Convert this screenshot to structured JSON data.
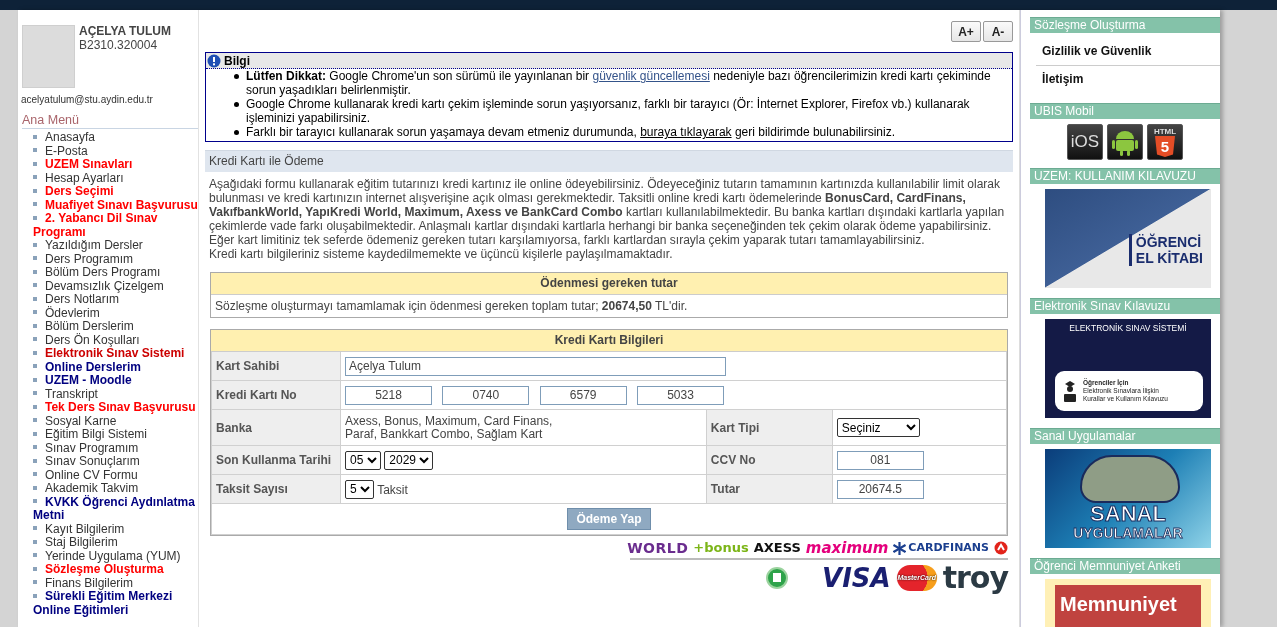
{
  "profile": {
    "name": "AÇELYA TULUM",
    "student_no": "B2310.320004",
    "email": "acelyatulum@stu.aydin.edu.tr"
  },
  "menu": {
    "title": "Ana Menü",
    "items": [
      {
        "label": "Anasayfa",
        "color": "#333333",
        "emphasized": false
      },
      {
        "label": "E-Posta",
        "color": "#333333",
        "emphasized": false
      },
      {
        "label": "UZEM Sınavları",
        "color": "#ff0000",
        "emphasized": true
      },
      {
        "label": "Hesap Ayarları",
        "color": "#333333",
        "emphasized": false
      },
      {
        "label": "Ders Seçimi",
        "color": "#ff0000",
        "emphasized": true
      },
      {
        "label": "Muafiyet Sınavı Başvurusu",
        "color": "#ff0000",
        "emphasized": true
      },
      {
        "label": "2. Yabancı Dil Sınav Programı",
        "color": "#ff0000",
        "emphasized": true
      },
      {
        "label": "Yazıldığım Dersler",
        "color": "#333333",
        "emphasized": false
      },
      {
        "label": "Ders Programım",
        "color": "#333333",
        "emphasized": false
      },
      {
        "label": "Bölüm Ders Programı",
        "color": "#333333",
        "emphasized": false
      },
      {
        "label": "Devamsızlık Çizelgem",
        "color": "#333333",
        "emphasized": false
      },
      {
        "label": "Ders Notlarım",
        "color": "#333333",
        "emphasized": false
      },
      {
        "label": "Ödevlerim",
        "color": "#333333",
        "emphasized": false
      },
      {
        "label": "Bölüm Derslerim",
        "color": "#333333",
        "emphasized": false
      },
      {
        "label": "Ders Ön Koşulları",
        "color": "#333333",
        "emphasized": false
      },
      {
        "label": "Elektronik Sınav Sistemi",
        "color": "#cc0000",
        "emphasized": true
      },
      {
        "label": "Online Derslerim",
        "color": "#000080",
        "emphasized": true
      },
      {
        "label": "UZEM - Moodle",
        "color": "#000080",
        "emphasized": true
      },
      {
        "label": "Transkript",
        "color": "#333333",
        "emphasized": false
      },
      {
        "label": "Tek Ders Sınav Başvurusu",
        "color": "#ff0000",
        "emphasized": true
      },
      {
        "label": "Sosyal Karne",
        "color": "#333333",
        "emphasized": false
      },
      {
        "label": "Eğitim Bilgi Sistemi",
        "color": "#333333",
        "emphasized": false
      },
      {
        "label": "Sınav Programım",
        "color": "#333333",
        "emphasized": false
      },
      {
        "label": "Sınav Sonuçlarım",
        "color": "#333333",
        "emphasized": false
      },
      {
        "label": "Online CV Formu",
        "color": "#333333",
        "emphasized": false
      },
      {
        "label": "Akademik Takvim",
        "color": "#333333",
        "emphasized": false
      },
      {
        "label": "KVKK Öğrenci Aydınlatma Metni",
        "color": "#000080",
        "emphasized": true
      },
      {
        "label": "Kayıt Bilgilerim",
        "color": "#333333",
        "emphasized": false
      },
      {
        "label": "Staj Bilgilerim",
        "color": "#333333",
        "emphasized": false
      },
      {
        "label": "Yerinde Uygulama (YUM)",
        "color": "#333333",
        "emphasized": false
      },
      {
        "label": "Sözleşme Oluşturma",
        "color": "#ff0000",
        "emphasized": true
      },
      {
        "label": "Finans Bilgilerim",
        "color": "#333333",
        "emphasized": false
      },
      {
        "label": "Sürekli Eğitim Merkezi Online Eğitimleri",
        "color": "#000080",
        "emphasized": true
      }
    ]
  },
  "font_buttons": [
    "A+",
    "A-"
  ],
  "notice": {
    "title": "Bilgi",
    "items": [
      [
        {
          "kind": "bold",
          "text": "Lütfen Dikkat:"
        },
        {
          "kind": "text",
          "text": " Google Chrome'un son sürümü ile yayınlanan bir "
        },
        {
          "kind": "link",
          "text": "güvenlik güncellemesi"
        },
        {
          "kind": "text",
          "text": " nedeniyle bazı öğrencilerimizin kredi kartı çekiminde sorun yaşadıkları belirlenmiştir."
        }
      ],
      [
        {
          "kind": "text",
          "text": "Google Chrome kullanarak kredi kartı çekim işleminde sorun yaşıyorsanız, farklı bir tarayıcı (Ör: İnternet Explorer, Firefox vb.) kullanarak işleminizi yapabilirsiniz."
        }
      ],
      [
        {
          "kind": "text",
          "text": "Farklı bir tarayıcı kullanarak sorun yaşamaya devam etmeniz durumunda, "
        },
        {
          "kind": "plain_link",
          "text": "buraya tıklayarak"
        },
        {
          "kind": "text",
          "text": " geri bildirimde bulunabilirsiniz."
        }
      ]
    ]
  },
  "payment": {
    "title": "Kredi Kartı ile Ödeme",
    "paragraphs": [
      "Aşağıdaki formu kullanarak eğitim tutarınızı kredi kartınız ile online ödeyebilirsiniz. Ödeyeceğiniz tutarın tamamının kartınızda kullanılabilir limit olarak bulunması ve kredi kartınızın internet alışverişine açık olması gerekmektedir. Taksitli online kredi kartı ödemelerinde **BonusCard, CardFinans, VakıfbankWorld, YapıKredi World, Maximum, Axess ve BankCard Combo** kartları kullanılabilmektedir. Bu banka kartları dışındaki kartlarla yapılan çekimlerde vade farkı oluşabilmektedir. Anlaşmalı kartlar dışındaki kartlarla herhangi bir banka seçeneğinden tek çekim olarak ödeme yapabilirsiniz.",
      "Eğer kart limitiniz tek seferde ödemeniz gereken tutarı karşılamıyorsa, farklı kartlardan sırayla çekim yaparak tutarı tamamlayabilirsiniz.",
      "Kredi kartı bilgileriniz sisteme kaydedilmemekte ve üçüncü kişilerle paylaşılmamaktadır."
    ]
  },
  "amount_due": {
    "title": "Ödenmesi gereken tutar",
    "text": "Sözleşme oluşturmayı tamamlamak için ödenmesi gereken toplam tutar; **20674,50** TL'dir."
  },
  "card_form": {
    "title": "Kredi Kartı Bilgileri",
    "cardholder": {
      "label": "Kart Sahibi",
      "value": "Açelya Tulum"
    },
    "card_number": {
      "label": "Kredi Kartı No",
      "values": [
        "5218",
        "0740",
        "6579",
        "5033"
      ]
    },
    "bank": {
      "label": "Banka",
      "text": "Axess, Bonus, Maximum, Card Finans,\nParaf, Bankkart Combo, Sağlam Kart"
    },
    "card_type": {
      "label": "Kart Tipi",
      "value": "Seçiniz"
    },
    "expiry": {
      "label": "Son Kullanma Tarihi",
      "month": "05",
      "year": "2029"
    },
    "cvv": {
      "label": "CCV No",
      "value": "081"
    },
    "installments": {
      "label": "Taksit Sayısı",
      "value": "5",
      "suffix": "Taksit"
    },
    "amount": {
      "label": "Tutar",
      "value": "20674.5"
    },
    "submit": "Ödeme Yap"
  },
  "bank_logos": [
    {
      "kind": "world",
      "text": "WORLD"
    },
    {
      "kind": "bonus",
      "text": "+bonus"
    },
    {
      "kind": "axess",
      "text": "AXESS"
    },
    {
      "kind": "maximum",
      "text": "maximum"
    },
    {
      "kind": "cardfinans",
      "text": "CARDFINANS"
    },
    {
      "kind": "paraf"
    }
  ],
  "card_logos": [
    {
      "kind": "seal"
    },
    {
      "kind": "visa",
      "text": "VISA"
    },
    {
      "kind": "mastercard",
      "text": "MasterCard"
    },
    {
      "kind": "troy",
      "text": "troy"
    }
  ],
  "right_sidebar": [
    {
      "kind": "links",
      "title": "Sözleşme Oluşturma",
      "items": [
        "Gizlilik ve Güvenlik",
        "İletişim"
      ]
    },
    {
      "kind": "apps",
      "title": "UBIS Mobil",
      "items": [
        {
          "kind": "ios",
          "text": "iOS"
        },
        {
          "kind": "android"
        },
        {
          "kind": "html5",
          "text": "5",
          "caption": "HTML"
        }
      ]
    },
    {
      "kind": "banner",
      "title": "UZEM: KULLANIM KILAVUZU",
      "banner": {
        "kind": "handbook",
        "lines": [
          "ÖĞRENCİ",
          "EL KİTABI"
        ]
      }
    },
    {
      "kind": "banner",
      "title": "Elektronik Sınav Kılavuzu",
      "banner": {
        "kind": "exam",
        "lines": [
          "ELEKTRONİK SINAV SİSTEMİ",
          "Öğrenciler İçin",
          "Elektronik Sınavlara İlişkin",
          "Kurallar ve Kullanım Kılavuzu"
        ]
      }
    },
    {
      "kind": "banner",
      "title": "Sanal Uygulamalar",
      "banner": {
        "kind": "virtual",
        "lines": [
          "SANAL",
          "UYGULAMALAR"
        ]
      }
    },
    {
      "kind": "banner",
      "title": "Öğrenci Memnuniyet Anketi",
      "banner": {
        "kind": "survey",
        "lines": [
          "Memnuniyet"
        ]
      }
    }
  ]
}
